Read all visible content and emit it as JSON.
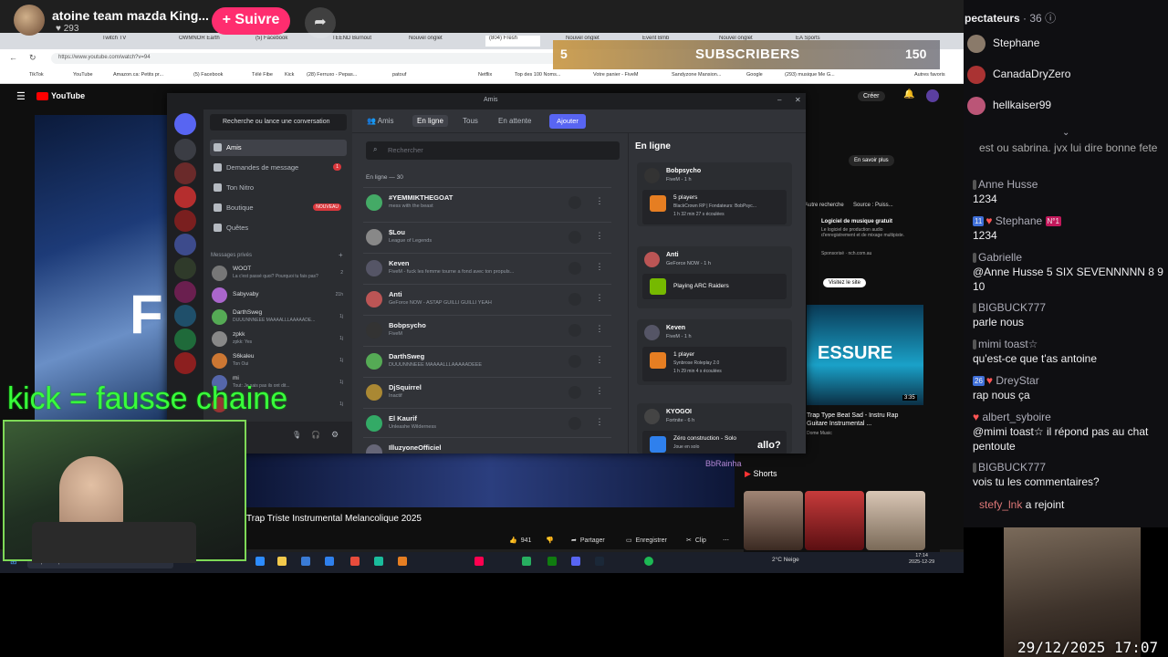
{
  "stream": {
    "streamer_name": "atoine team mazda King...",
    "follower_count": "293",
    "follow_label": "+ Suivre",
    "share_icon": "share-arrow-icon",
    "sub_goal_current": "5",
    "sub_goal_label": "SUBSCRIBERS",
    "sub_goal_target": "150",
    "overlay_text": "kick = fausse chaine",
    "timestamp": "29/12/2025 17:07",
    "accent_color": "#ff2d6f"
  },
  "browser": {
    "url": "https://www.youtube.com/watch?v=94",
    "tabs": [
      "Twitch TV",
      "OWMNOR Earth",
      "(5) Facebook",
      "TEEND Burnout",
      "Nouvel onglet",
      "(804) Fresh",
      "Nouvel onglet",
      "Event Bmb",
      "Nouvel onglet",
      "EA Sports"
    ],
    "bookmarks": [
      "TikTok",
      "YouTube",
      "Amazon.ca: Petits pr...",
      "(5) Facebook",
      "Télé Fibe",
      "Kick",
      "(28) Ferruxo - Pepas...",
      "patouf",
      "Netflix",
      "Top des 100 Noms...",
      "Votre panier - FiveM",
      "Sandyzone Mansion...",
      "Google",
      "(293) musique Me G..."
    ],
    "all_favorites": "Autres favoris"
  },
  "youtube": {
    "logo": "YouTube",
    "create_label": "Créer",
    "video_title": "Trap Triste Instrumental Melancolique 2025",
    "big_letter": "F",
    "like_count": "941",
    "share_label": "Partager",
    "save_label": "Enregistrer",
    "clip_label": "Clip",
    "shorts_label": "Shorts",
    "ad_learn_more": "En savoir plus",
    "ad_chip_search": "Autre recherche",
    "ad_chip_source": "Source : Puiss...",
    "ad_title": "Logiciel de musique gratuit",
    "ad_desc": "Le logiciel de production audio d'enregistrement et de mixage multipiste.",
    "ad_sponsored": "Sponsorisé · nch.com.au",
    "ad_visit": "Visitez le site",
    "rec_thumb_text": "ESSURE",
    "rec_duration": "3:35",
    "rec_title": "Trap Type Beat Sad - Instru Rap Guitare Instrumental ...",
    "rec_channel": "Dome Music",
    "overlay_name": "BbRainha",
    "overlay_msg": "allo?"
  },
  "taskbar": {
    "search_placeholder": "Taper ici pour rechercher",
    "weather": "2°C Neige",
    "time": "17:14",
    "date": "2025-12-29"
  },
  "discord": {
    "window_title": "Amis",
    "search_button": "Recherche ou lance une conversation",
    "nav": [
      {
        "label": "Amis",
        "badge": ""
      },
      {
        "label": "Demandes de message",
        "badge": "1"
      },
      {
        "label": "Ton Nitro",
        "badge": ""
      },
      {
        "label": "Boutique",
        "badge": "NOUVEAU"
      },
      {
        "label": "Quêtes",
        "badge": ""
      }
    ],
    "dm_header": "Messages privés",
    "dms": [
      {
        "name": "WOOT",
        "status": "La c'est passé quoi? Pourquoi tu fais pas?",
        "count": "2"
      },
      {
        "name": "Sabyvaby",
        "status": "",
        "count": "21h"
      },
      {
        "name": "DarthSweg",
        "status": "DUUUNNNEEE MAAAALLLAAAAADE...",
        "count": "1j"
      },
      {
        "name": "zpkk",
        "status": "zpkk: Yes",
        "count": "1j"
      },
      {
        "name": "S6kaleu",
        "status": "Ton Oui",
        "count": "1j"
      },
      {
        "name": "mi",
        "status": "Tout: Je sais pas ils ont dit...",
        "count": "1j"
      },
      {
        "name": "",
        "status": "",
        "count": "1j"
      }
    ],
    "tabs": [
      "Amis",
      "En ligne",
      "Tous",
      "En attente"
    ],
    "add_button": "Ajouter",
    "search_placeholder": "Rechercher",
    "online_count": "En ligne — 30",
    "friends": [
      {
        "name": "#YEMMIKTHEGOAT",
        "status": "mess with the beast"
      },
      {
        "name": "$Lou",
        "status": "League of Legends"
      },
      {
        "name": "Keven",
        "status": "FiveM - fuck les femme tourne a fond avec ton propuls..."
      },
      {
        "name": "Anti",
        "status": "GeForce NOW - ASTAP GUILLI GUILLI YEAH"
      },
      {
        "name": "Bobpsycho",
        "status": "FiveM"
      },
      {
        "name": "DarthSweg",
        "status": "DUUUNNNEEE MAAAALLLAAAAADEEE"
      },
      {
        "name": "DjSquirrel",
        "status": "Inactif"
      },
      {
        "name": "El Kaurif",
        "status": "Unleashe Wilderness"
      },
      {
        "name": "IlluzyoneOfficiel",
        "status": ""
      }
    ],
    "side_title": "En ligne",
    "activities": [
      {
        "name": "Bobpsycho",
        "sub": "FiveM - 1 h",
        "game": "5 players",
        "detail": "BlackCrown RP | Fondateurs: BobPsyc...",
        "time": "1 h 32 min 27 s écoulées"
      },
      {
        "name": "Anti",
        "sub": "GeForce NOW - 1 h",
        "game": "Playing ARC Raiders",
        "detail": "",
        "time": ""
      },
      {
        "name": "Keven",
        "sub": "FiveM - 1 h",
        "game": "1 player",
        "detail": "Synbrose Roleplay 2.0",
        "time": "1 h 29 min 4 s écoulées"
      },
      {
        "name": "KYOGOI",
        "sub": "Fortnite - 6 h",
        "game": "Zéro construction - Solo",
        "detail": "Joue en solo",
        "time": ""
      }
    ]
  },
  "chat": {
    "spectators_label": "pectateurs",
    "spectators_count": "· 36",
    "spectators": [
      "Stephane",
      "CanadaDryZero",
      "hellkaiser99"
    ],
    "messages": [
      {
        "user": "",
        "text": "est ou sabrina. jvx lui dire bonne fete"
      },
      {
        "user": "Anne Husse",
        "text": "1234"
      },
      {
        "user": "Stephane",
        "badge": "11",
        "badge2": "N°1",
        "text": "1234"
      },
      {
        "user": "Gabrielle",
        "text": "@Anne Husse 5 SIX SEVENNNNN 8 9 10"
      },
      {
        "user": "BIGBUCK777",
        "text": "parle nous"
      },
      {
        "user": "mimi toast☆",
        "text": "qu'est-ce que t'as antoine"
      },
      {
        "user": "DreyStar",
        "badge": "26",
        "text": "rap nous ça"
      },
      {
        "user": "albert_syboire",
        "text": "@mimi toast☆ il répond pas au chat pentoute"
      },
      {
        "user": "BIGBUCK777",
        "text": "vois tu les commentaires?"
      },
      {
        "user": "stefy_lnk",
        "text": "a rejoint"
      }
    ]
  }
}
